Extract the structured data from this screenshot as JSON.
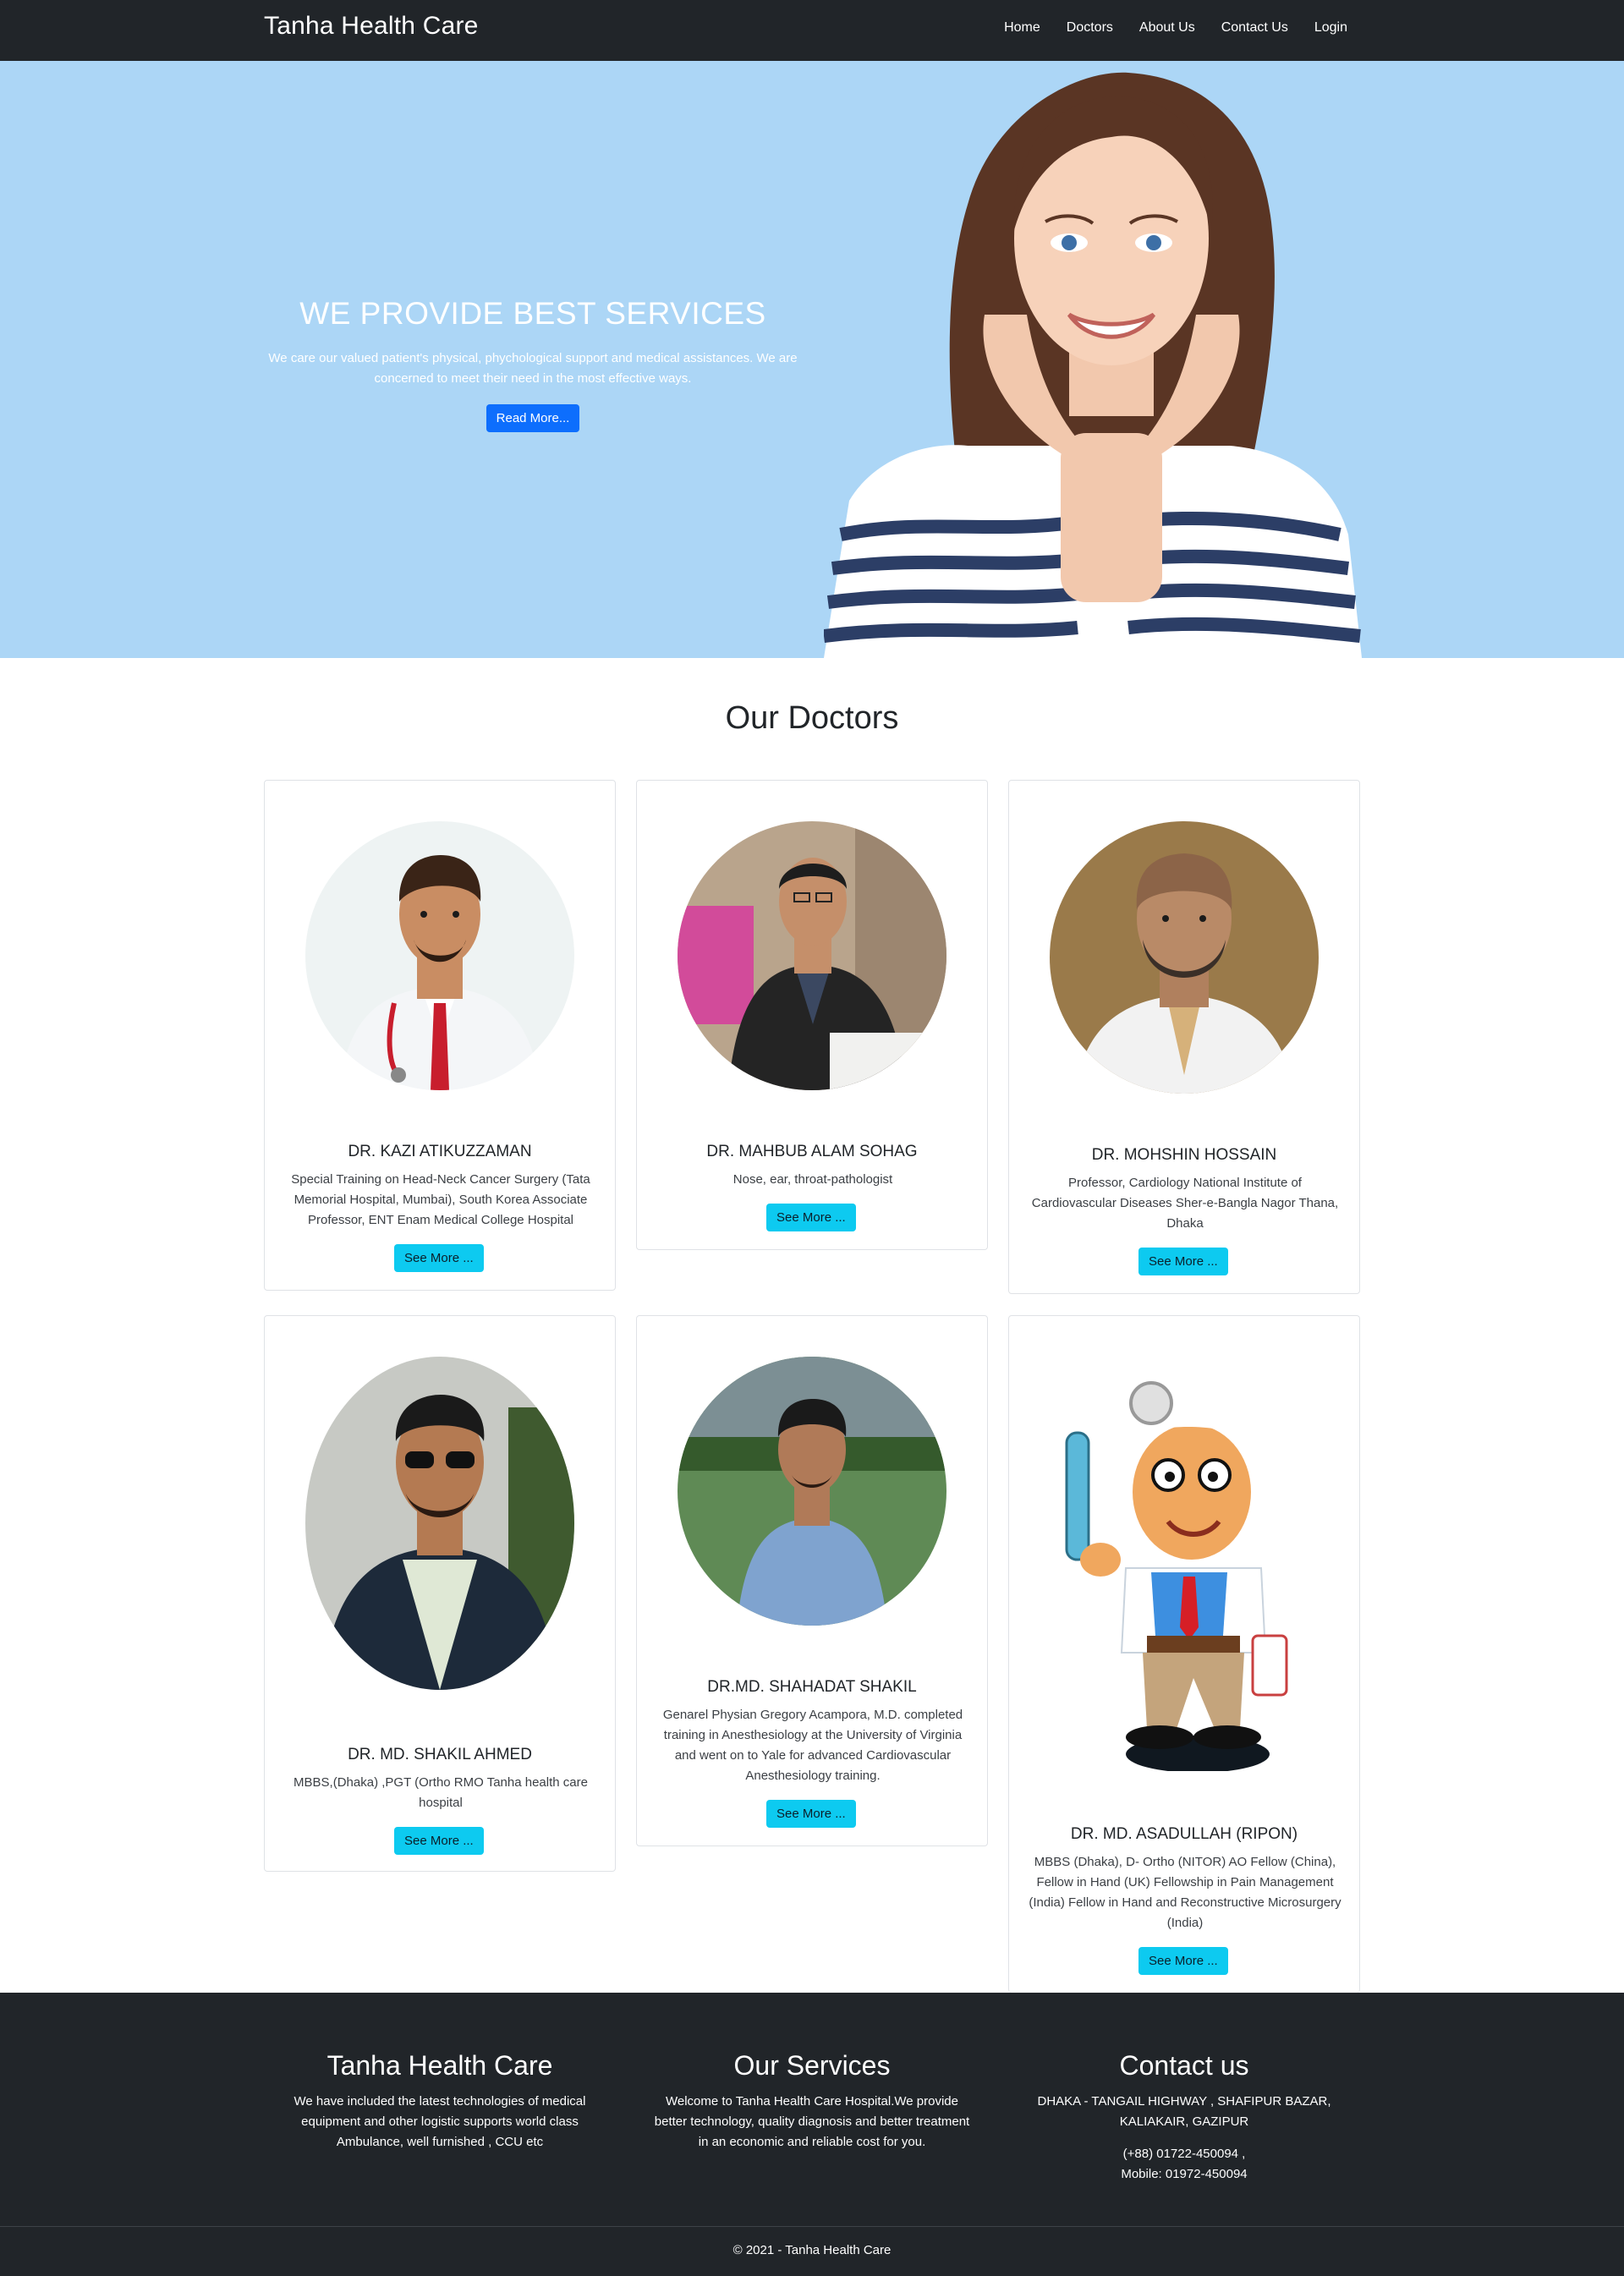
{
  "navbar": {
    "brand": "Tanha Health Care",
    "links": [
      "Home",
      "Doctors",
      "About Us",
      "Contact Us",
      "Login"
    ]
  },
  "hero": {
    "title": "WE PROVIDE BEST SERVICES",
    "description": "We care our valued patient's physical, phychological support and medical assistances. We are concerned to meet their need in the most effective ways.",
    "button": "Read More...",
    "image": "smiling-woman-photo",
    "background_color": "#acd6f6"
  },
  "doctors_section": {
    "title": "Our Doctors",
    "doctors": [
      {
        "name": "DR. KAZI ATIKUZZAMAN",
        "description": "Special Training on Head-Neck Cancer Surgery (Tata Memorial Hospital, Mumbai), South Korea Associate Professor, ENT Enam Medical College Hospital",
        "button": "See More ...",
        "photo": "doctor-white-coat-photo"
      },
      {
        "name": "DR. MAHBUB ALAM SOHAG",
        "description": "Nose, ear, throat-pathologist",
        "button": "See More ...",
        "photo": "doctor-at-desk-photo"
      },
      {
        "name": "DR. MOHSHIN HOSSAIN",
        "description": "Professor, Cardiology National Institute of Cardiovascular Diseases Sher-e-Bangla Nagor Thana, Dhaka",
        "button": "See More ...",
        "photo": "doctor-portrait-photo"
      },
      {
        "name": "DR. MD. SHAKIL AHMED",
        "description": "MBBS,(Dhaka) ,PGT (Ortho RMO Tanha health care hospital",
        "button": "See More ...",
        "photo": "doctor-sunglasses-photo"
      },
      {
        "name": "DR.MD. SHAHADAT SHAKIL",
        "description": "Genarel Physian Gregory Acampora, M.D. completed training in Anesthesiology at the University of Virginia and went on to Yale for advanced Cardiovascular Anesthesiology training.",
        "button": "See More ...",
        "photo": "doctor-outdoor-photo"
      },
      {
        "name": "DR. MD. ASADULLAH (RIPON)",
        "description": "MBBS (Dhaka), D- Ortho (NITOR) AO Fellow (China), Fellow in Hand (UK) Fellowship in Pain Management (India) Fellow in Hand and Reconstructive Microsurgery (India)",
        "button": "See More ...",
        "photo": "cartoon-doctor-illustration"
      }
    ]
  },
  "footer": {
    "about": {
      "title": "Tanha Health Care",
      "text": "We have included the latest technologies of medical equipment and other logistic supports world class Ambulance, well furnished , CCU etc"
    },
    "services": {
      "title": "Our Services",
      "text": "Welcome to Tanha Health Care Hospital.We provide better technology, quality diagnosis and better treatment in an economic and reliable cost for you."
    },
    "contact": {
      "title": "Contact us",
      "address": "DHAKA - TANGAIL HIGHWAY , SHAFIPUR BAZAR, KALIAKAIR, GAZIPUR",
      "phone": "(+88) 01722-450094 ,",
      "mobile": "Mobile: 01972-450094"
    },
    "copyright": "© 2021 - Tanha Health Care"
  },
  "colors": {
    "dark": "#212529",
    "primary_button": "#0d6efd",
    "info_button": "#0dcaf0"
  }
}
